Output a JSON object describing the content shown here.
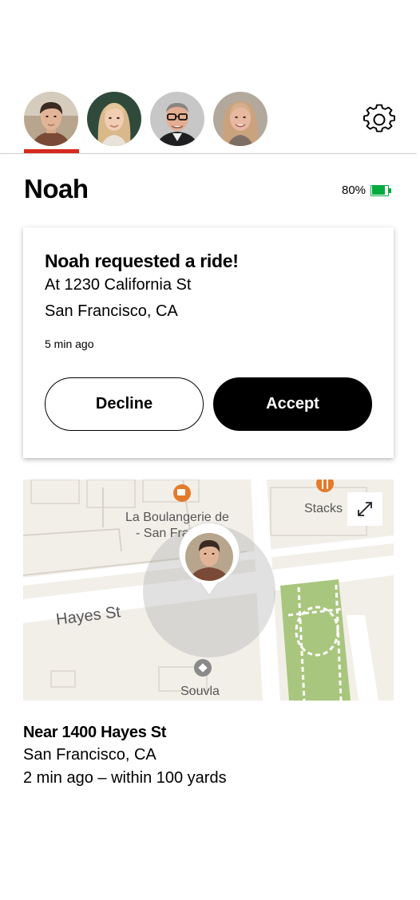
{
  "family_members": [
    {
      "name": "Noah",
      "selected": true
    },
    {
      "name": "",
      "selected": false
    },
    {
      "name": "",
      "selected": false
    },
    {
      "name": "",
      "selected": false
    }
  ],
  "header": {
    "settings_icon": "gear-icon",
    "title": "Noah",
    "battery_percent_label": "80%",
    "battery_level": 0.8,
    "battery_color": "#00ac3e",
    "accent_color": "#d52b1e"
  },
  "ride_request": {
    "title": "Noah requested a ride!",
    "address_line1": "At 1230 California St",
    "address_line2": "San Francisco, CA",
    "time_ago": "5 min ago",
    "decline_label": "Decline",
    "accept_label": "Accept"
  },
  "map": {
    "street_label": "Hayes St",
    "poi_cafe": "La Boulangerie de",
    "poi_cafe_line2": "- San Fra",
    "poi_cafe_line2_tail": "o",
    "poi_restaurant": "Stacks",
    "poi_store": "Souvla",
    "expand_icon": "expand-icon"
  },
  "location": {
    "title": "Near 1400 Hayes St",
    "city": "San Francisco, CA",
    "detail": "2 min ago – within 100 yards"
  }
}
